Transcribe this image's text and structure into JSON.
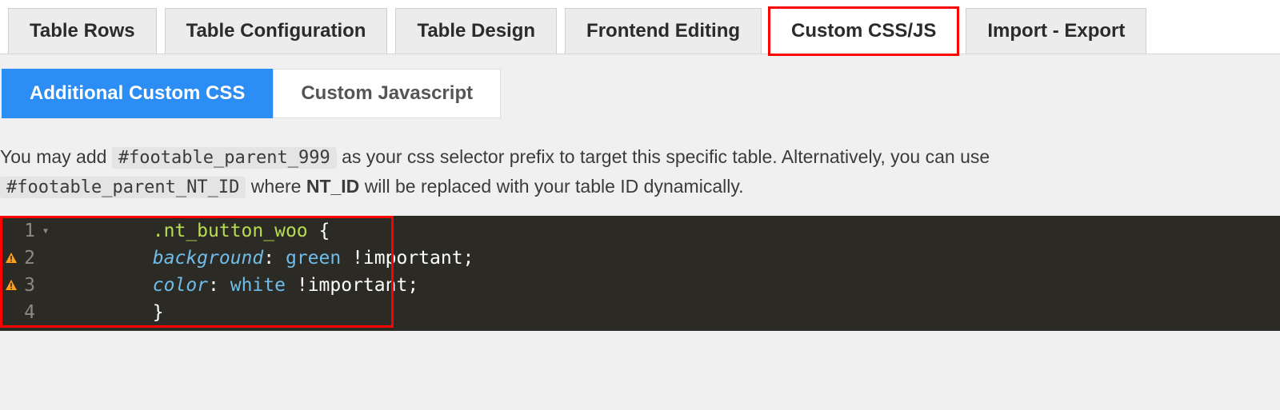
{
  "tabs": {
    "rows": "Table Rows",
    "config": "Table Configuration",
    "design": "Table Design",
    "frontend": "Frontend Editing",
    "cssjs": "Custom CSS/JS",
    "import": "Import - Export"
  },
  "subtabs": {
    "css": "Additional Custom CSS",
    "js": "Custom Javascript"
  },
  "info": {
    "prefix": "You may add ",
    "selector1": "#footable_parent_999",
    "mid": " as your css selector prefix to target this specific table. Alternatively, you can use ",
    "selector2": "#footable_parent_NT_ID",
    "mid2": " where ",
    "ntid": "NT_ID",
    "suffix": " will be replaced with your table ID dynamically."
  },
  "editor": {
    "lines": [
      "1",
      "2",
      "3",
      "4"
    ],
    "code": {
      "l1_sel": ".nt_button_woo",
      "l1_brace": " {",
      "l2_prop": "background",
      "l2_val": "green",
      "l2_imp": "!important;",
      "l3_prop": "color",
      "l3_val": "white",
      "l3_imp": "!important;",
      "l4_brace": "}"
    }
  }
}
